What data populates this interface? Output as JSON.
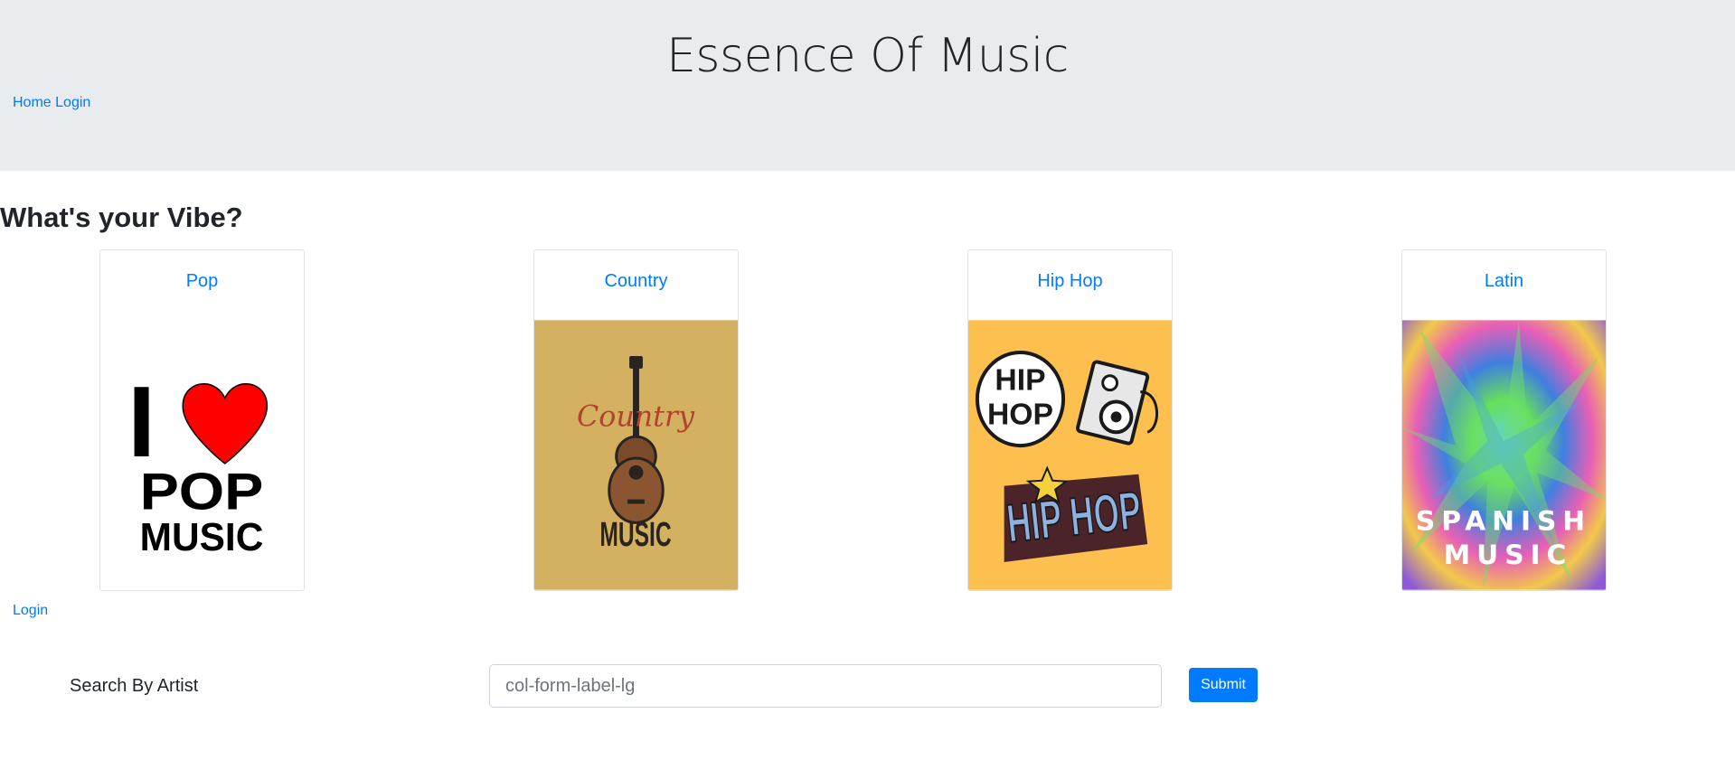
{
  "header": {
    "title": "Essence Of Music",
    "nav": [
      {
        "label": "Home"
      },
      {
        "label": "Login"
      }
    ],
    "background": "#e9ecef"
  },
  "main": {
    "heading": "What's your Vibe?",
    "genres": [
      {
        "title": "Pop",
        "image_icon": "i-love-pop-music-art",
        "image_text": [
          "I",
          "POP",
          "MUSIC"
        ]
      },
      {
        "title": "Country",
        "image_icon": "guitar-country-music-art",
        "image_text": [
          "Country",
          "MUSIC"
        ]
      },
      {
        "title": "Hip Hop",
        "image_icon": "hip-hop-speaker-graffiti-art",
        "image_text": [
          "HIP",
          "HOP",
          "HIP HOP"
        ]
      },
      {
        "title": "Latin",
        "image_icon": "color-explosion-spanish-music-art",
        "image_text": [
          "SPANISH",
          "MUSIC"
        ]
      }
    ],
    "login_link": "Login"
  },
  "search": {
    "label": "Search By Artist",
    "placeholder": "col-form-label-lg",
    "value": "",
    "submit_label": "Submit"
  },
  "colors": {
    "link": "#007bff",
    "button": "#007bff",
    "text": "#212529"
  }
}
